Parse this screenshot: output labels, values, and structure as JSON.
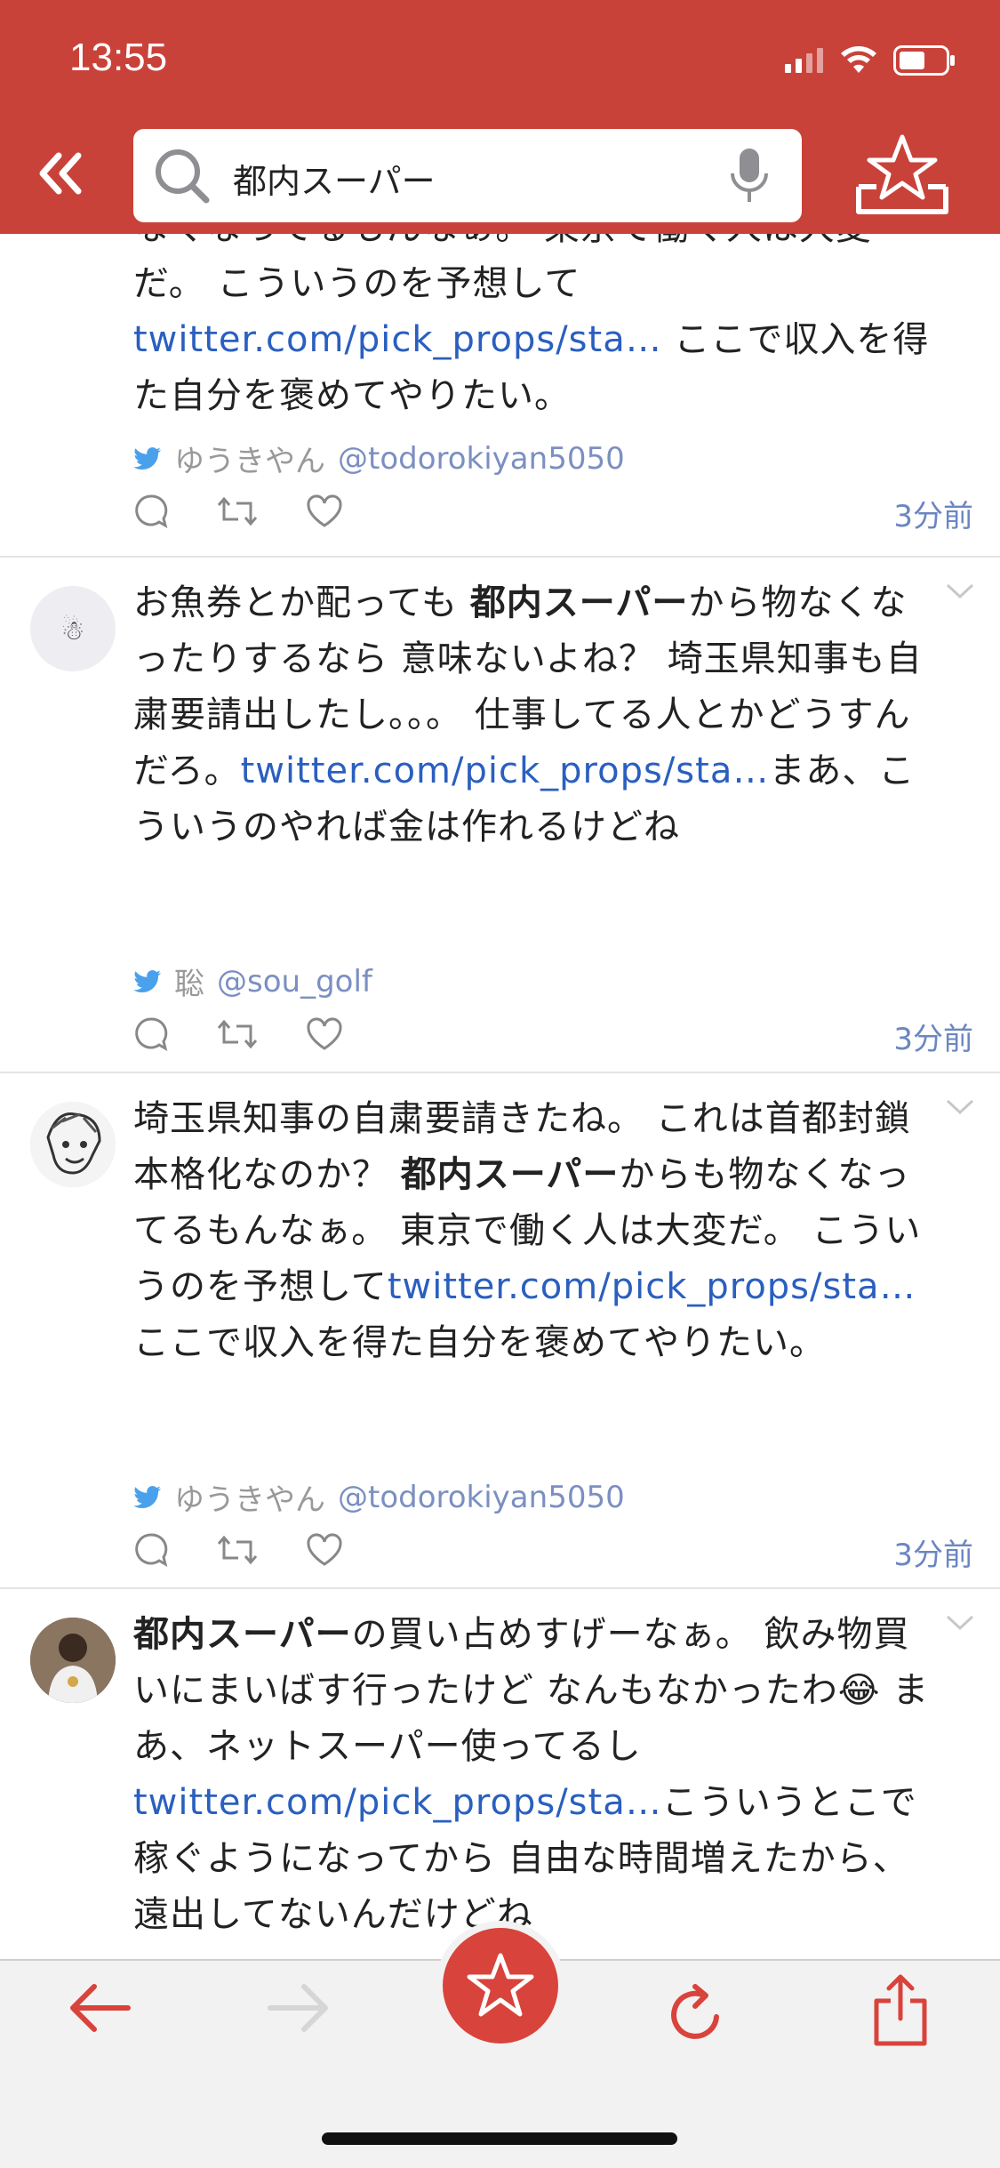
{
  "status": {
    "time": "13:55"
  },
  "search": {
    "query": "都内スーパー"
  },
  "colors": {
    "brand": "#c9423a",
    "link": "#2a5fbf",
    "twitter": "#4aa1eb"
  },
  "tweets": [
    {
      "text_before": "なくなってるもんなぁ。 東京で働く人は大変だ。 こういうのを予想して",
      "link": "twitter.com/pick_props/sta…",
      "text_after": " ここで収入を得た自分を褒めてやりたい。",
      "name": "ゆうきやん",
      "handle": "@todorokiyan5050",
      "time": "3分前"
    },
    {
      "text_pre": "お魚券とか配っても ",
      "keyword": "都内スーパー",
      "text_before": "から物なくなったりするなら 意味ないよね？ 埼玉県知事も自粛要請出したし。。。 仕事してる人とかどうすんだろ。",
      "link": "twitter.com/pick_props/sta…",
      "text_after": "まあ、こういうのやれば金は作れるけどね",
      "name": "聡",
      "handle": "@sou_golf",
      "time": "3分前"
    },
    {
      "text_pre": "埼玉県知事の自粛要請きたね。 これは首都封鎖本格化なのか？ ",
      "keyword": "都内スーパー",
      "text_before": "からも物なくなってるもんなぁ。 東京で働く人は大変だ。 こういうのを予想して",
      "link": "twitter.com/pick_props/sta…",
      "text_after": " ここで収入を得た自分を褒めてやりたい。",
      "name": "ゆうきやん",
      "handle": "@todorokiyan5050",
      "time": "3分前"
    },
    {
      "keyword": "都内スーパー",
      "text_before": "の買い占めすげーなぁ。 飲み物買いにまいばす行ったけど なんもなかったわ😂 まあ、ネットスーパー使ってるし",
      "link": "twitter.com/pick_props/sta…",
      "text_after": "こういうとこで稼ぐようになってから 自由な時間増えたから、遠出してないんだけどね"
    }
  ]
}
